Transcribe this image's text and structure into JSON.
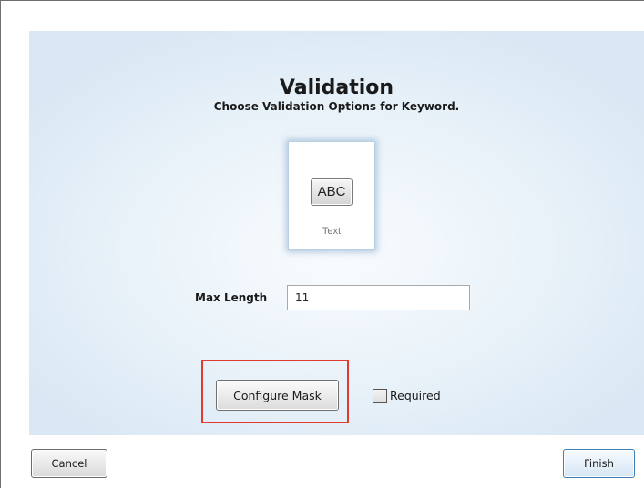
{
  "dialog": {
    "title": "Validation",
    "subtitle": "Choose Validation Options for Keyword."
  },
  "type_options": [
    {
      "icon": "text-abc-icon",
      "icon_text": "ABC",
      "label": "Text",
      "selected": true
    }
  ],
  "max_length": {
    "label": "Max Length",
    "value": "11"
  },
  "configure_mask": {
    "label": "Configure Mask",
    "highlight_color": "#e03a31"
  },
  "required": {
    "label": "Required",
    "checked": false
  },
  "footer": {
    "cancel_label": "Cancel",
    "finish_label": "Finish"
  }
}
